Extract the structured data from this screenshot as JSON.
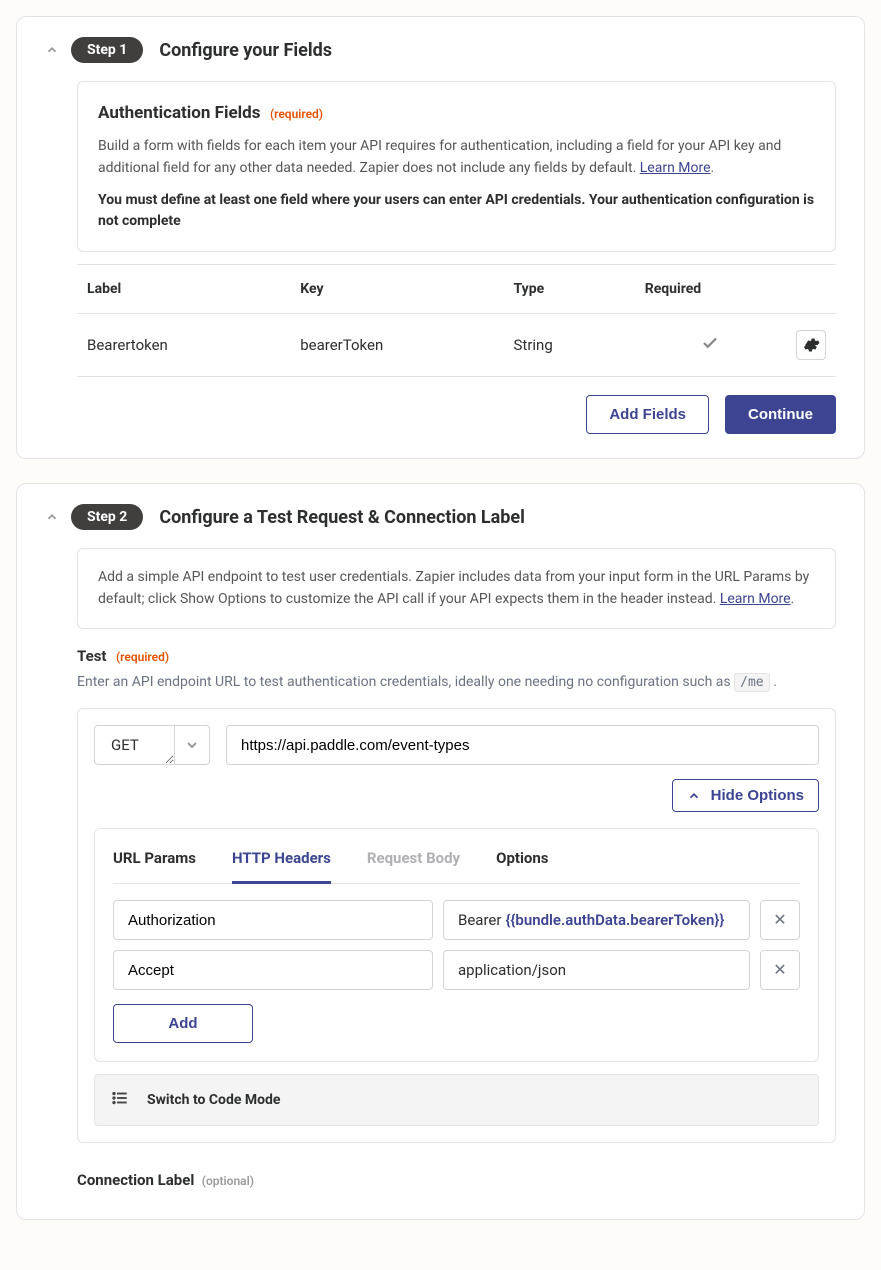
{
  "step1": {
    "pill": "Step 1",
    "title": "Configure your Fields",
    "box": {
      "heading": "Authentication Fields",
      "req": "(required)",
      "p1": "Build a form with fields for each item your API requires for authentication, including a field for your API key and additional field for any other data needed. Zapier does not include any fields by default. ",
      "learn": "Learn More",
      "p2": "You must define at least one field where your users can enter API credentials. Your authentication configuration is not complete"
    },
    "table": {
      "h1": "Label",
      "h2": "Key",
      "h3": "Type",
      "h4": "Required",
      "r1c1": "Bearertoken",
      "r1c2": "bearerToken",
      "r1c3": "String"
    },
    "addFields": "Add Fields",
    "continue": "Continue"
  },
  "step2": {
    "pill": "Step 2",
    "title": "Configure a Test Request & Connection Label",
    "infoP": "Add a simple API endpoint to test user credentials. Zapier includes data from your input form in the URL Params by default; click Show Options to customize the API call if your API expects them in the header instead. ",
    "learn": "Learn More",
    "testLabel": "Test",
    "testReq": "(required)",
    "testHelp1": "Enter an API endpoint URL to test authentication credentials, ideally one needing no configuration such as ",
    "testHelpCode": "/me",
    "method": "GET",
    "url": "https://api.paddle.com/event-types",
    "hideOptions": "Hide Options",
    "tabs": {
      "t1": "URL Params",
      "t2": "HTTP Headers",
      "t3": "Request Body",
      "t4": "Options"
    },
    "headers": [
      {
        "key": "Authorization",
        "valPrefix": "Bearer ",
        "valTemplate": "{{bundle.authData.bearerToken}}"
      },
      {
        "key": "Accept",
        "valPrefix": "application/json",
        "valTemplate": ""
      }
    ],
    "add": "Add",
    "codeMode": "Switch to Code Mode",
    "connLabel": "Connection Label",
    "optional": "(optional)"
  }
}
